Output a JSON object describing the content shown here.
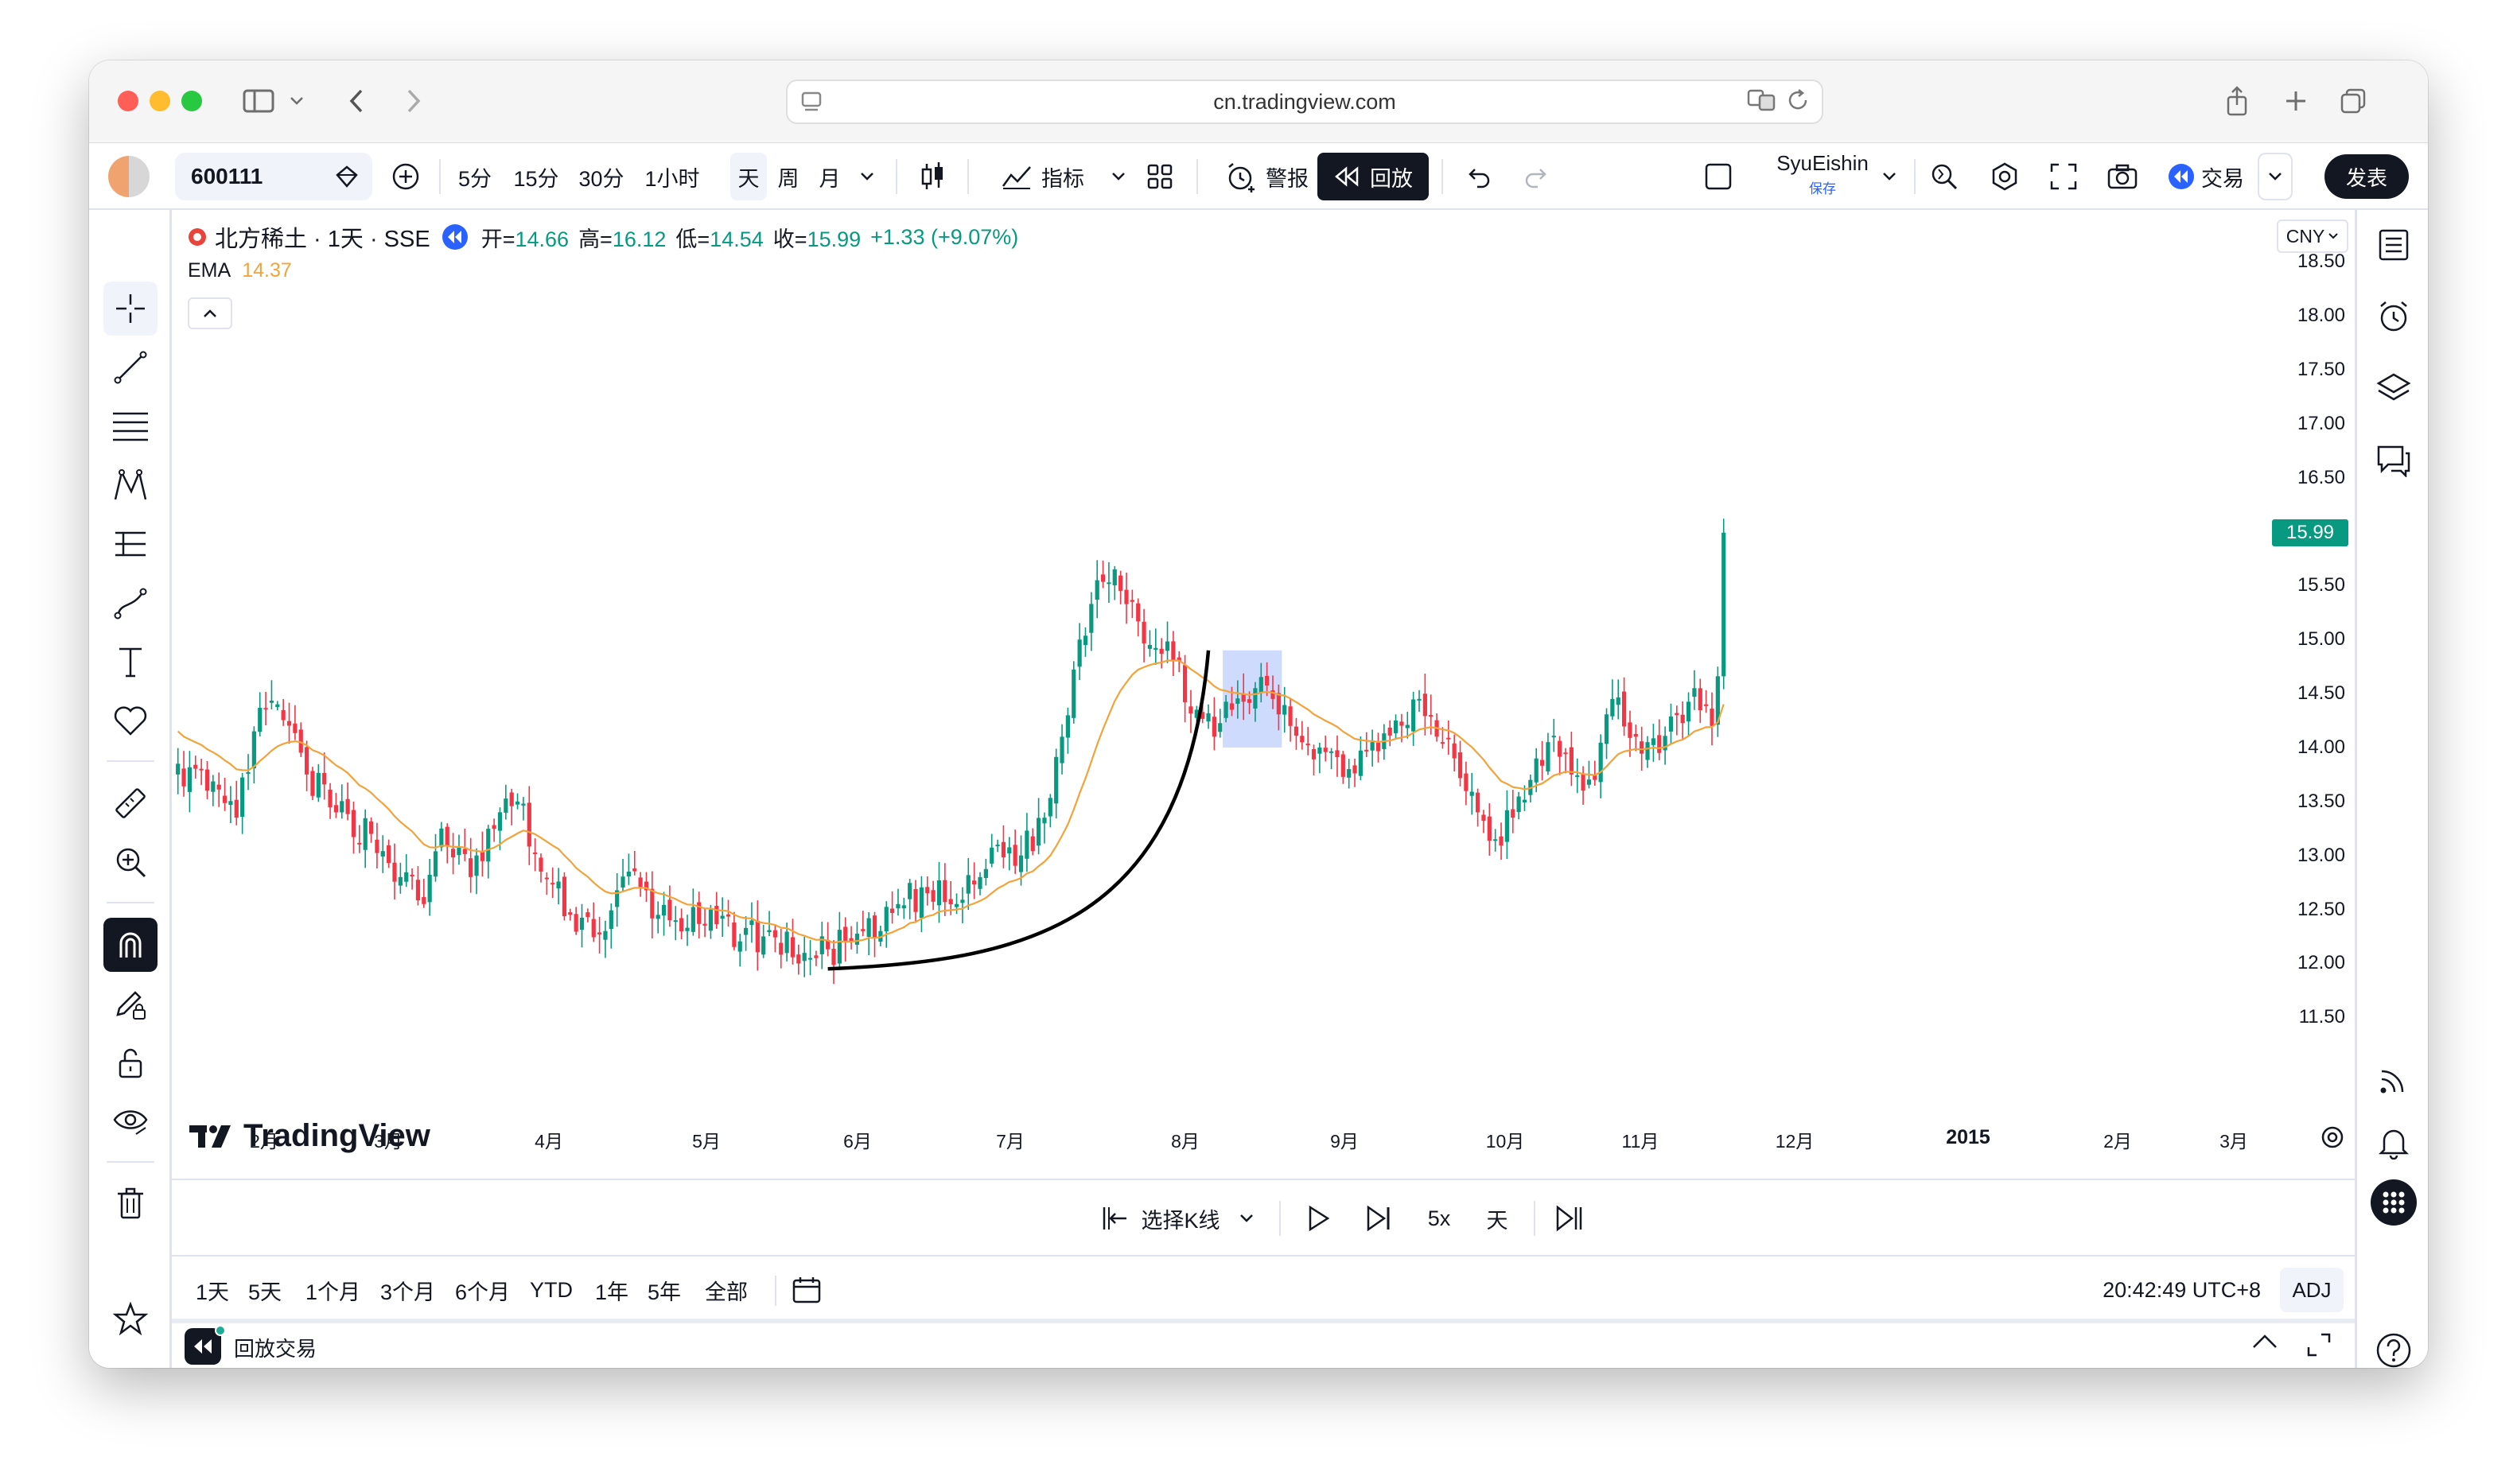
{
  "browser": {
    "url": "cn.tradingview.com"
  },
  "toolbar": {
    "symbol": "600111",
    "intervals": [
      "5分",
      "15分",
      "30分",
      "1小时",
      "天",
      "周",
      "月"
    ],
    "indicators_label": "指标",
    "alert_label": "警报",
    "replay_label": "回放",
    "user_name": "SyuEishin",
    "user_sub": "保存",
    "trade_label": "交易",
    "publish_label": "发表"
  },
  "legend": {
    "title": "北方稀土 · 1天 · SSE",
    "open_k": "开=",
    "open_v": "14.66",
    "high_k": "高=",
    "high_v": "16.12",
    "low_k": "低=",
    "low_v": "14.54",
    "close_k": "收=",
    "close_v": "15.99",
    "change": "+1.33 (+9.07%)",
    "ema_label": "EMA",
    "ema_value": "14.37",
    "currency": "CNY"
  },
  "colors": {
    "up": "#089981",
    "down": "#f23645",
    "ema": "#f2a33a",
    "highlight": "#c6d5fb",
    "accent": "#2962ff"
  },
  "chart_data": {
    "type": "candlestick",
    "title": "北方稀土 · 1天 · SSE",
    "ylim": [
      11.2,
      18.7
    ],
    "y_ticks": [
      "18.50",
      "18.00",
      "17.50",
      "17.00",
      "16.50",
      "16.00",
      "15.50",
      "15.00",
      "14.50",
      "14.00",
      "13.50",
      "13.00",
      "12.50",
      "12.00",
      "11.50"
    ],
    "last_price": "15.99",
    "x_ticks": [
      "2月",
      "3月",
      "4月",
      "5月",
      "6月",
      "7月",
      "8月",
      "9月",
      "10月",
      "11月",
      "12月",
      "2015",
      "2月",
      "3月"
    ],
    "anchors": [
      {
        "i": 0,
        "c": 13.85
      },
      {
        "i": 5,
        "c": 13.6
      },
      {
        "i": 10,
        "c": 13.35
      },
      {
        "i": 13,
        "c": 14.15
      },
      {
        "i": 17,
        "c": 14.4
      },
      {
        "i": 22,
        "c": 13.75
      },
      {
        "i": 27,
        "c": 13.4
      },
      {
        "i": 33,
        "c": 13.2
      },
      {
        "i": 38,
        "c": 12.8
      },
      {
        "i": 42,
        "c": 12.55
      },
      {
        "i": 45,
        "c": 13.25
      },
      {
        "i": 50,
        "c": 12.8
      },
      {
        "i": 55,
        "c": 13.4
      },
      {
        "i": 58,
        "c": 13.5
      },
      {
        "i": 62,
        "c": 12.85
      },
      {
        "i": 67,
        "c": 12.45
      },
      {
        "i": 73,
        "c": 12.3
      },
      {
        "i": 77,
        "c": 12.85
      },
      {
        "i": 82,
        "c": 12.45
      },
      {
        "i": 90,
        "c": 12.35
      },
      {
        "i": 100,
        "c": 12.25
      },
      {
        "i": 108,
        "c": 12.05
      },
      {
        "i": 115,
        "c": 12.2
      },
      {
        "i": 120,
        "c": 12.3
      },
      {
        "i": 123,
        "c": 12.55
      },
      {
        "i": 128,
        "c": 12.65
      },
      {
        "i": 133,
        "c": 12.55
      },
      {
        "i": 137,
        "c": 12.8
      },
      {
        "i": 140,
        "c": 13.1
      },
      {
        "i": 144,
        "c": 13.0
      },
      {
        "i": 148,
        "c": 13.35
      },
      {
        "i": 151,
        "c": 14.1
      },
      {
        "i": 154,
        "c": 15.0
      },
      {
        "i": 157,
        "c": 15.55
      },
      {
        "i": 160,
        "c": 15.65
      },
      {
        "i": 163,
        "c": 15.35
      },
      {
        "i": 166,
        "c": 14.95
      },
      {
        "i": 170,
        "c": 14.8
      },
      {
        "i": 174,
        "c": 14.35
      },
      {
        "i": 177,
        "c": 14.1
      },
      {
        "i": 180,
        "c": 14.35
      },
      {
        "i": 184,
        "c": 14.55
      },
      {
        "i": 187,
        "c": 14.45
      },
      {
        "i": 190,
        "c": 14.2
      },
      {
        "i": 195,
        "c": 14.0
      },
      {
        "i": 200,
        "c": 13.8
      },
      {
        "i": 204,
        "c": 14.05
      },
      {
        "i": 208,
        "c": 14.25
      },
      {
        "i": 212,
        "c": 14.45
      },
      {
        "i": 215,
        "c": 14.1
      },
      {
        "i": 218,
        "c": 13.9
      },
      {
        "i": 222,
        "c": 13.4
      },
      {
        "i": 225,
        "c": 13.15
      },
      {
        "i": 228,
        "c": 13.35
      },
      {
        "i": 231,
        "c": 13.7
      },
      {
        "i": 234,
        "c": 14.05
      },
      {
        "i": 238,
        "c": 13.75
      },
      {
        "i": 242,
        "c": 13.7
      },
      {
        "i": 245,
        "c": 14.45
      },
      {
        "i": 249,
        "c": 14.1
      },
      {
        "i": 253,
        "c": 13.95
      },
      {
        "i": 256,
        "c": 14.3
      },
      {
        "i": 259,
        "c": 14.55
      },
      {
        "i": 262,
        "c": 14.2
      },
      {
        "i": 263,
        "c": 14.66
      },
      {
        "i": 264,
        "c": 15.99
      }
    ],
    "bar_count": 265,
    "annotations": [
      "curve-under-lows",
      "replay-selection-box"
    ]
  },
  "time_axis": {
    "labels": [
      "2月",
      "3月",
      "4月",
      "5月",
      "6月",
      "7月",
      "8月",
      "9月",
      "10月",
      "11月",
      "12月",
      "2015",
      "2月",
      "3月"
    ]
  },
  "replay": {
    "select_bar_label": "选择K线",
    "speed": "5x",
    "interval": "天"
  },
  "ranges": {
    "items": [
      "1天",
      "5天",
      "1个月",
      "3个月",
      "6个月",
      "YTD",
      "1年",
      "5年",
      "全部"
    ],
    "clock": "20:42:49 UTC+8",
    "adj": "ADJ"
  },
  "bottom": {
    "panel_label": "回放交易"
  },
  "brand": {
    "logo_text": "TradingView"
  }
}
